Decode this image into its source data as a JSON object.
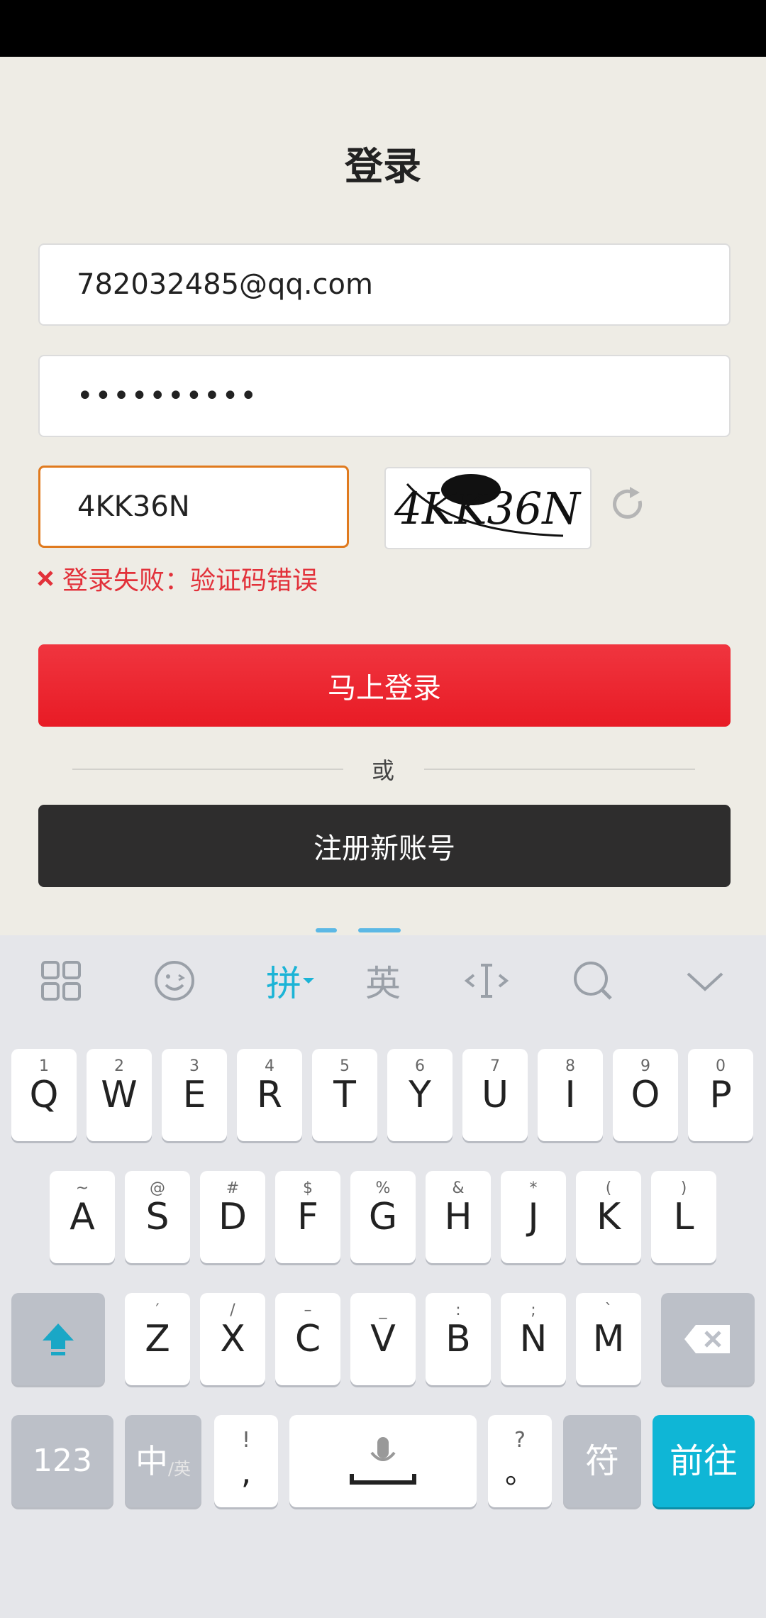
{
  "title": "登录",
  "form": {
    "email_value": "782032485@qq.com",
    "password_value": "••••••••••",
    "captcha_value": "4KK36N",
    "captcha_image_text": "4KK36N",
    "error_message": "登录失败：验证码错误",
    "login_label": "马上登录",
    "or_label": "或",
    "register_label": "注册新账号"
  },
  "keyboard": {
    "toolbar": {
      "pinyin": "拼",
      "english": "英"
    },
    "row1": [
      {
        "sub": "1",
        "main": "Q"
      },
      {
        "sub": "2",
        "main": "W"
      },
      {
        "sub": "3",
        "main": "E"
      },
      {
        "sub": "4",
        "main": "R"
      },
      {
        "sub": "5",
        "main": "T"
      },
      {
        "sub": "6",
        "main": "Y"
      },
      {
        "sub": "7",
        "main": "U"
      },
      {
        "sub": "8",
        "main": "I"
      },
      {
        "sub": "9",
        "main": "O"
      },
      {
        "sub": "0",
        "main": "P"
      }
    ],
    "row2": [
      {
        "sub": "~",
        "main": "A"
      },
      {
        "sub": "@",
        "main": "S"
      },
      {
        "sub": "#",
        "main": "D"
      },
      {
        "sub": "$",
        "main": "F"
      },
      {
        "sub": "%",
        "main": "G"
      },
      {
        "sub": "&",
        "main": "H"
      },
      {
        "sub": "*",
        "main": "J"
      },
      {
        "sub": "(",
        "main": "K"
      },
      {
        "sub": ")",
        "main": "L"
      }
    ],
    "row3": [
      {
        "sub": "′",
        "main": "Z"
      },
      {
        "sub": "/",
        "main": "X"
      },
      {
        "sub": "–",
        "main": "C"
      },
      {
        "sub": "_",
        "main": "V"
      },
      {
        "sub": ":",
        "main": "B"
      },
      {
        "sub": ";",
        "main": "N"
      },
      {
        "sub": "`",
        "main": "M"
      }
    ],
    "num_label": "123",
    "lang_label": "中",
    "lang_sub": "/英",
    "comma_sub": "!",
    "comma_main": ",",
    "period_sub": "?",
    "period_main": "。",
    "symbol_label": "符",
    "go_label": "前往"
  },
  "colors": {
    "accent_red": "#e81b25",
    "keyboard_go": "#0fb6d6",
    "error": "#e2313a"
  }
}
